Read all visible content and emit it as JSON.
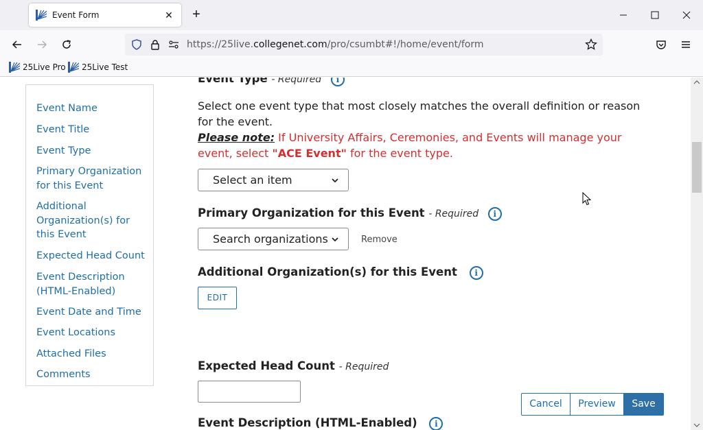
{
  "browser": {
    "tab_title": "Event Form",
    "tab_close": "✕",
    "new_tab": "+",
    "url_prefix": "https://25live.",
    "url_domain": "collegenet.com",
    "url_path": "/pro/csumbt#!/home/event/form",
    "bookmarks": [
      "25Live Pro",
      "25Live Test"
    ]
  },
  "sidebar": {
    "items": [
      "Event Name",
      "Event Title",
      "Event Type",
      "Primary Organization for this Event",
      "Additional Organization(s) for this Event",
      "Expected Head Count",
      "Event Description (HTML-Enabled)",
      "Event Date and Time",
      "Event Locations",
      "Attached Files",
      "Comments"
    ]
  },
  "form": {
    "event_type": {
      "label": "Event Type",
      "required": "- Required",
      "description": "Select one event type that most closely matches the overall definition or reason for the event.",
      "note_label": "Please note:",
      "note_text_1": " If University Affairs, Ceremonies, and Events will manage your event, select ",
      "note_bold": "\"ACE Event\"",
      "note_text_2": " for the event type.",
      "select_value": "Select an item"
    },
    "primary_org": {
      "label": "Primary Organization for this Event",
      "required": "- Required",
      "select_value": "Search organizations",
      "remove_label": "Remove"
    },
    "additional_org": {
      "label": "Additional Organization(s) for this Event",
      "edit_label": "EDIT"
    },
    "head_count": {
      "label": "Expected Head Count",
      "required": "- Required",
      "value": ""
    },
    "description": {
      "label": "Event Description (HTML-Enabled)"
    },
    "info_glyph": "i"
  },
  "actions": {
    "cancel": "Cancel",
    "preview": "Preview",
    "save": "Save"
  },
  "colors": {
    "link": "#1e6ea8",
    "note_red": "#d32f2f",
    "save_bg": "#2f6fa7"
  }
}
